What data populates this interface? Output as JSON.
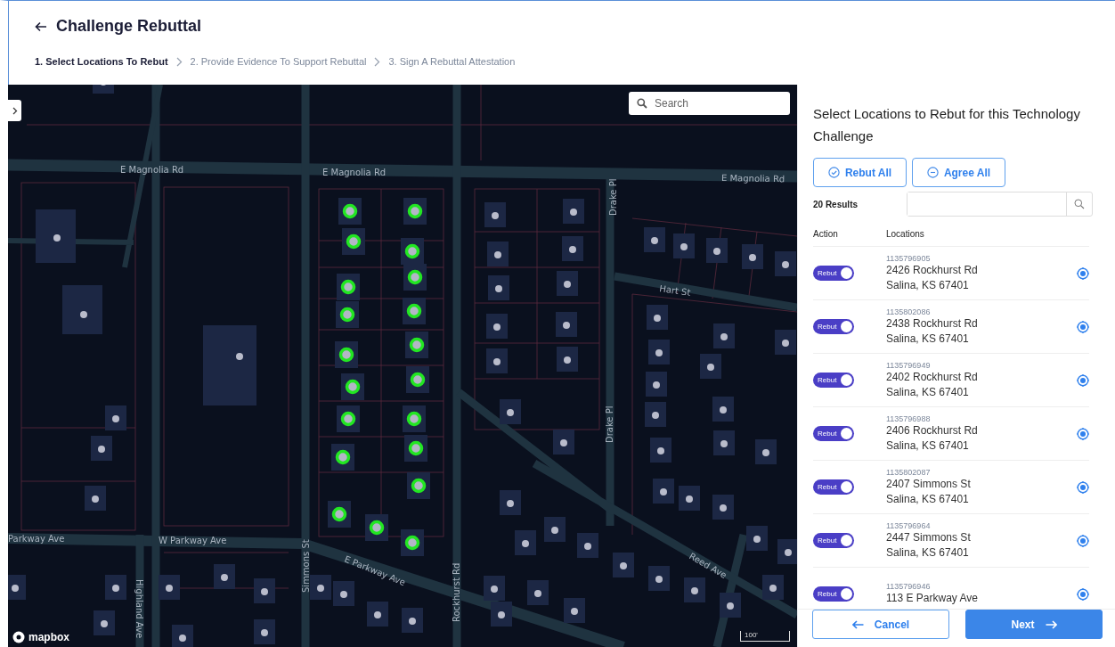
{
  "header": {
    "title": "Challenge Rebuttal"
  },
  "steps": [
    {
      "label": "1. Select Locations To Rebut",
      "selected": true
    },
    {
      "label": "2. Provide Evidence To Support Rebuttal",
      "selected": false
    },
    {
      "label": "3. Sign A Rebuttal Attestation",
      "selected": false
    }
  ],
  "map": {
    "search": {
      "placeholder": "Search"
    },
    "street_labels": [
      "E Magnolia Rd",
      "E Magnolia Rd",
      "E Magnolia Rd",
      "Drake Pl",
      "Hart St",
      "Drake Pl",
      "Parkway Ave",
      "W Parkway Ave",
      "Simmons St",
      "E Parkway Ave",
      "Rockhurst Rd",
      "Highland Ave",
      "Reed Ave"
    ],
    "logo": "mapbox",
    "scale": "100'"
  },
  "panel": {
    "heading": "Select Locations to Rebut for this Technology Challenge",
    "buttons": [
      {
        "label": "Rebut All",
        "kind": "check"
      },
      {
        "label": "Agree All",
        "kind": "minus"
      }
    ],
    "results": "20 Results",
    "columns": [
      "Action",
      "Locations"
    ],
    "rows": [
      {
        "toggle": "Rebut",
        "on": true,
        "id": "1135796905",
        "street": "2426 Rockhurst Rd",
        "city": "Salina, KS 67401"
      },
      {
        "toggle": "Rebut",
        "on": true,
        "id": "1135802086",
        "street": "2438 Rockhurst Rd",
        "city": "Salina, KS 67401"
      },
      {
        "toggle": "Rebut",
        "on": true,
        "id": "1135796949",
        "street": "2402 Rockhurst Rd",
        "city": "Salina, KS 67401"
      },
      {
        "toggle": "Rebut",
        "on": true,
        "id": "1135796988",
        "street": "2406 Rockhurst Rd",
        "city": "Salina, KS 67401"
      },
      {
        "toggle": "Rebut",
        "on": true,
        "id": "1135802087",
        "street": "2407 Simmons St",
        "city": "Salina, KS 67401"
      },
      {
        "toggle": "Rebut",
        "on": true,
        "id": "1135796964",
        "street": "2447 Simmons St",
        "city": "Salina, KS 67401"
      },
      {
        "toggle": "Rebut",
        "on": true,
        "id": "1135796946",
        "street": "113 E Parkway Ave"
      }
    ],
    "cancel": "Cancel",
    "next": "Next"
  }
}
